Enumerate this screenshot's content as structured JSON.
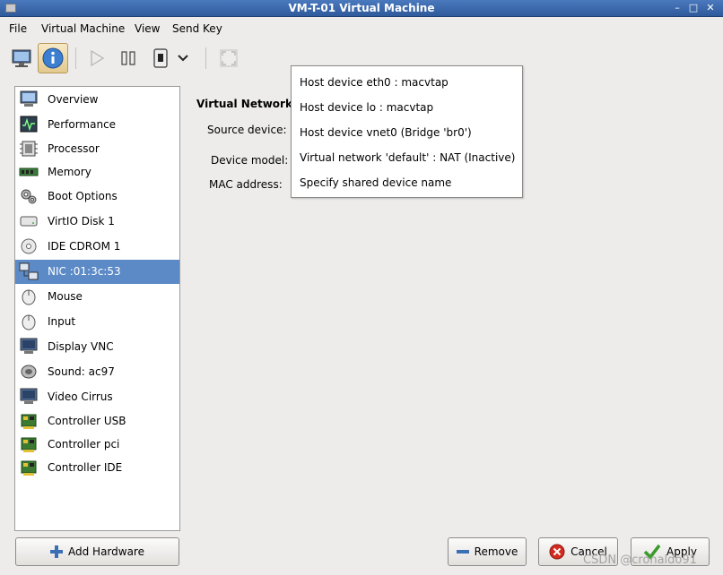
{
  "window": {
    "title": "VM-T-01 Virtual Machine",
    "minimize_glyph": "–",
    "maximize_glyph": "□",
    "close_glyph": "✕"
  },
  "menubar": {
    "items": [
      "File",
      "Virtual Machine",
      "View",
      "Send Key"
    ]
  },
  "toolbar": {
    "icons": [
      "console-icon",
      "info-icon",
      "run-icon",
      "pause-icon",
      "shutdown-icon",
      "chevron-down-icon",
      "fullscreen-icon"
    ]
  },
  "sidebar": {
    "items": [
      {
        "label": "Overview",
        "icon": "overview-icon"
      },
      {
        "label": "Performance",
        "icon": "performance-icon"
      },
      {
        "label": "Processor",
        "icon": "processor-icon"
      },
      {
        "label": "Memory",
        "icon": "memory-icon"
      },
      {
        "label": "Boot Options",
        "icon": "boot-options-icon"
      },
      {
        "label": "VirtIO Disk 1",
        "icon": "disk-icon"
      },
      {
        "label": "IDE CDROM 1",
        "icon": "cdrom-icon"
      },
      {
        "label": "NIC :01:3c:53",
        "icon": "nic-icon",
        "selected": true
      },
      {
        "label": "Mouse",
        "icon": "mouse-icon"
      },
      {
        "label": "Input",
        "icon": "input-icon"
      },
      {
        "label": "Display VNC",
        "icon": "display-icon"
      },
      {
        "label": "Sound: ac97",
        "icon": "sound-icon"
      },
      {
        "label": "Video Cirrus",
        "icon": "video-icon"
      },
      {
        "label": "Controller USB",
        "icon": "controller-icon"
      },
      {
        "label": "Controller pci",
        "icon": "controller-icon"
      },
      {
        "label": "Controller IDE",
        "icon": "controller-icon"
      }
    ]
  },
  "details": {
    "section_title": "Virtual Network I",
    "source_device_label": "Source device:",
    "device_model_label": "Device model:",
    "mac_address_label": "MAC address:"
  },
  "source_dropdown": {
    "options": [
      "Host device eth0 : macvtap",
      "Host device lo : macvtap",
      "Host device vnet0 (Bridge 'br0')",
      "Virtual network 'default' : NAT (Inactive)",
      "Specify shared device name"
    ]
  },
  "buttons": {
    "add_hardware": "Add Hardware",
    "remove": "Remove",
    "cancel": "Cancel",
    "apply": "Apply"
  },
  "watermark": "CSDN @cronaldo91",
  "colors": {
    "selection": "#5b8ac7",
    "titlebar": "#3b68ad",
    "window_bg": "#edeceb"
  }
}
